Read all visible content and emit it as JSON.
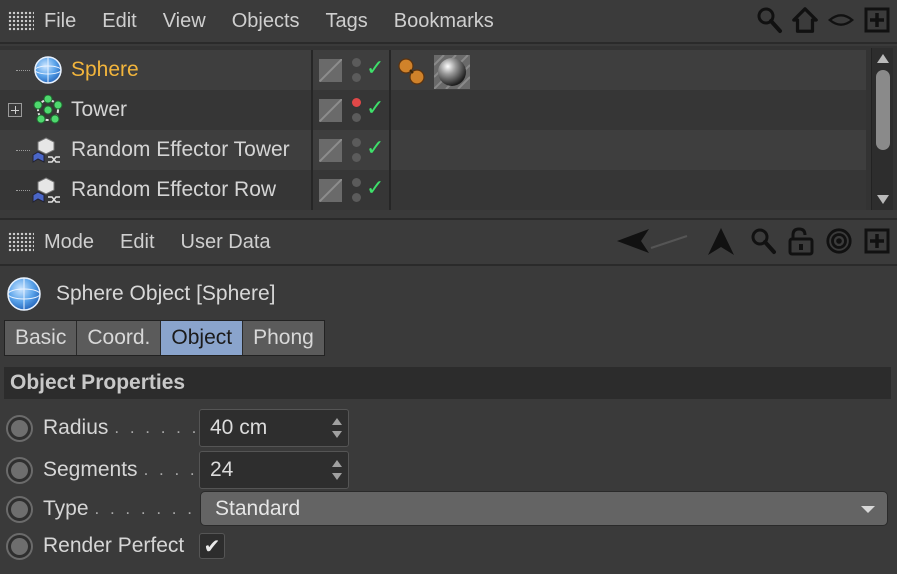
{
  "object_manager": {
    "menu": [
      "File",
      "Edit",
      "View",
      "Objects",
      "Tags",
      "Bookmarks"
    ],
    "toolbar_icons": [
      "search-icon",
      "home-icon",
      "eye-icon",
      "new-window-icon"
    ],
    "objects": [
      {
        "name": "Sphere",
        "selected": true,
        "icon": "sphere-icon",
        "visibility": "default",
        "enabled": true,
        "tags": [
          "phong-tag-icon",
          "material-tag-icon"
        ]
      },
      {
        "name": "Tower",
        "selected": false,
        "icon": "cloner-icon",
        "visibility": "editor-off",
        "enabled": true,
        "expandable": true,
        "tags": []
      },
      {
        "name": "Random Effector Tower",
        "selected": false,
        "icon": "random-effector-icon",
        "visibility": "default",
        "enabled": true,
        "tags": []
      },
      {
        "name": "Random Effector Row",
        "selected": false,
        "icon": "random-effector-icon",
        "visibility": "default",
        "enabled": true,
        "tags": []
      }
    ]
  },
  "attribute_manager": {
    "menu": [
      "Mode",
      "Edit",
      "User Data"
    ],
    "toolbar_icons": [
      "back-arrow-icon",
      "up-arrow-icon",
      "search-icon",
      "lock-icon",
      "target-icon",
      "new-window-icon"
    ],
    "object_title": "Sphere Object [Sphere]",
    "tabs": [
      "Basic",
      "Coord.",
      "Object",
      "Phong"
    ],
    "active_tab": "Object",
    "section_title": "Object Properties",
    "params": {
      "radius": {
        "label": "Radius",
        "dots": ". . . . . .",
        "value": "40 cm"
      },
      "segments": {
        "label": "Segments",
        "dots": ". . . .",
        "value": "24"
      },
      "type": {
        "label": "Type",
        "dots": ". . . . . . . .",
        "value": "Standard"
      },
      "render_perfect": {
        "label": "Render Perfect",
        "checked": true,
        "check_glyph": "✔"
      }
    }
  },
  "colors": {
    "selected_object": "#f2b53c",
    "active_tab": "#8aa4cc",
    "check_green": "#3ee06a",
    "editor_off_red": "#e04848"
  },
  "glyphs": {
    "check": "✓"
  }
}
